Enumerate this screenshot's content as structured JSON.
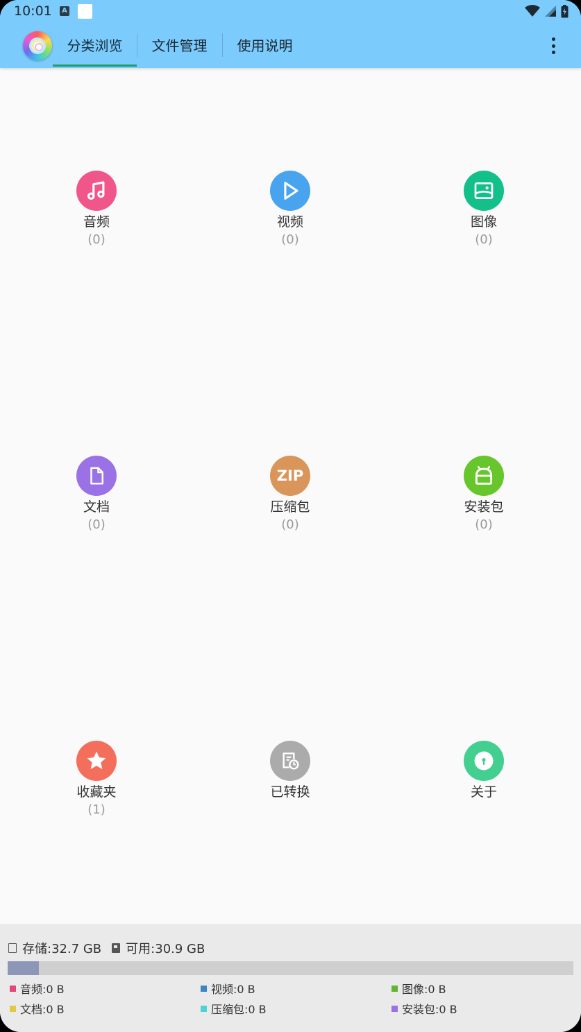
{
  "status_bar": {
    "time": "10:01",
    "notif_letter": "A"
  },
  "tabs": [
    {
      "label": "分类浏览",
      "active": true
    },
    {
      "label": "文件管理",
      "active": false
    },
    {
      "label": "使用说明",
      "active": false
    }
  ],
  "colors": {
    "appbar": "#7ccbfd",
    "tab_indicator": "#1e9c66"
  },
  "categories": [
    {
      "label": "音频",
      "count": "(0)",
      "color": "#f0568a",
      "icon": "music-note-icon"
    },
    {
      "label": "视频",
      "count": "(0)",
      "color": "#48a4ef",
      "icon": "play-icon"
    },
    {
      "label": "图像",
      "count": "(0)",
      "color": "#13c08a",
      "icon": "image-icon"
    },
    {
      "label": "文档",
      "count": "(0)",
      "color": "#9a72e6",
      "icon": "document-icon"
    },
    {
      "label": "压缩包",
      "count": "(0)",
      "color": "#d9955a",
      "icon": "zip-icon",
      "icon_text": "ZIP"
    },
    {
      "label": "安装包",
      "count": "(0)",
      "color": "#66c62b",
      "icon": "android-icon"
    },
    {
      "label": "收藏夹",
      "count": "(1)",
      "color": "#f36f5c",
      "icon": "star-icon"
    },
    {
      "label": "已转换",
      "count": "",
      "color": "#ababab",
      "icon": "converted-file-icon"
    },
    {
      "label": "关于",
      "count": "",
      "color": "#43cf8f",
      "icon": "info-icon"
    }
  ],
  "storage": {
    "total": "存储:32.7 GB",
    "available": "可用:30.9 GB",
    "used_fraction": 0.055
  },
  "legend": [
    {
      "label": "音频:0 B",
      "color": "#e0457b"
    },
    {
      "label": "视频:0 B",
      "color": "#3d86c6"
    },
    {
      "label": "图像:0 B",
      "color": "#62b52e"
    },
    {
      "label": "文档:0 B",
      "color": "#e3c845"
    },
    {
      "label": "压缩包:0 B",
      "color": "#4fd2d6"
    },
    {
      "label": "安装包:0 B",
      "color": "#9a72e6"
    }
  ]
}
